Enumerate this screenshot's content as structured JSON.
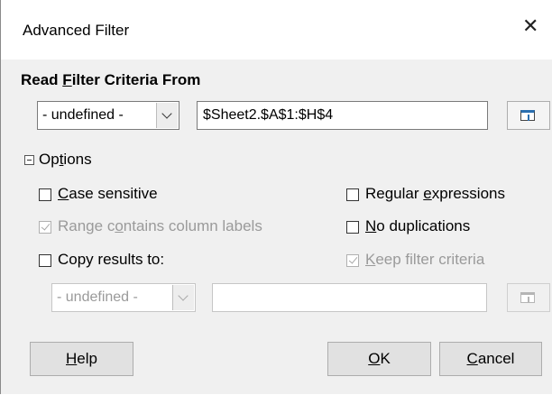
{
  "window": {
    "title": "Advanced Filter"
  },
  "icons": {
    "close": "close-icon",
    "shrink": "shrink-dialog-icon",
    "dropdown": "chevron-down-icon",
    "collapse": "minus-square-icon",
    "check": "checkmark-icon"
  },
  "criteria": {
    "heading_pre": "Read ",
    "heading_ul": "F",
    "heading_post": "ilter Criteria From",
    "named_range": "- undefined -",
    "range_value": "$Sheet2.$A$1:$H$4"
  },
  "options": {
    "label_pre": "Op",
    "label_ul": "t",
    "label_post": "ions",
    "expanded": true,
    "case_sensitive": {
      "pre": "",
      "ul": "C",
      "post": "ase sensitive",
      "checked": false,
      "enabled": true
    },
    "range_labels": {
      "pre": "Range c",
      "ul": "o",
      "post": "ntains column labels",
      "checked": true,
      "enabled": false
    },
    "copy_results": {
      "pre": "Copy results to:",
      "ul": "",
      "post": "",
      "checked": false,
      "enabled": true
    },
    "copy_target": {
      "named_range": "- undefined -",
      "value": ""
    },
    "regular_expressions": {
      "pre": "Regular ",
      "ul": "e",
      "post": "xpressions",
      "checked": false,
      "enabled": true
    },
    "no_duplications": {
      "pre": "",
      "ul": "N",
      "post": "o duplications",
      "checked": false,
      "enabled": true
    },
    "keep_criteria": {
      "pre": "",
      "ul": "K",
      "post": "eep filter criteria",
      "checked": true,
      "enabled": false
    }
  },
  "buttons": {
    "help": {
      "ul": "H",
      "post": "elp"
    },
    "ok": {
      "ul": "O",
      "post": "K"
    },
    "cancel": {
      "ul": "C",
      "post": "ancel"
    }
  },
  "colors": {
    "accent": "#2a6fb0",
    "disabled_text": "#9a9a9a",
    "body_bg": "#f0f0f0"
  }
}
